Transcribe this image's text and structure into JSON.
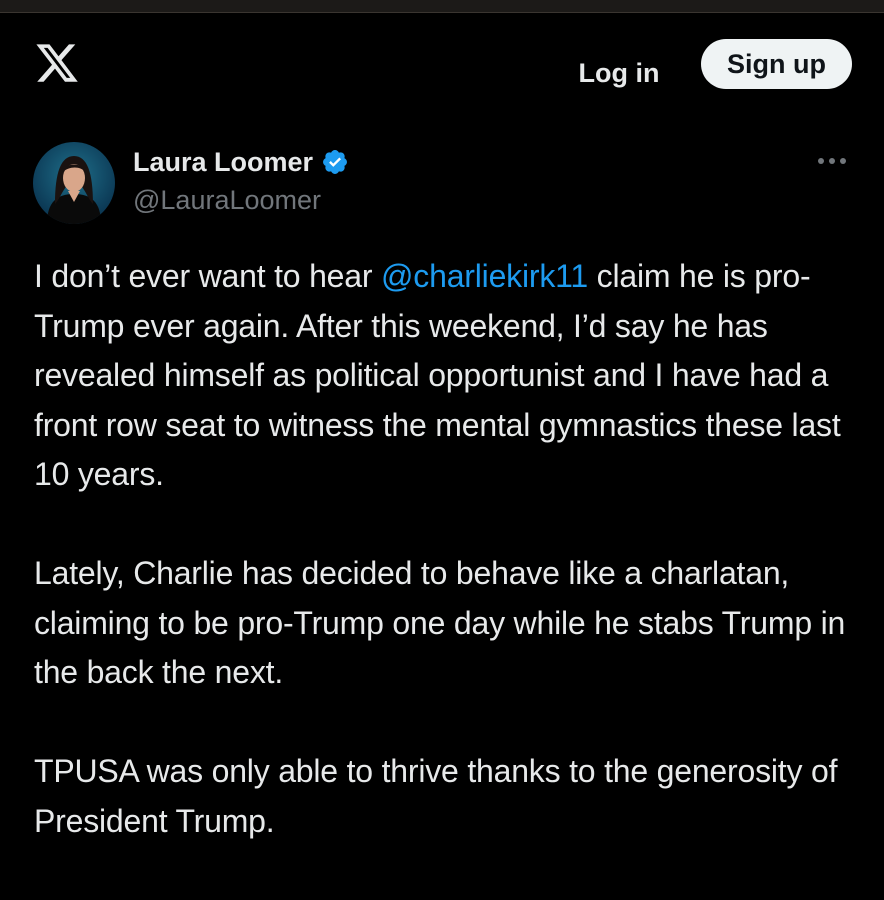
{
  "header": {
    "logo_icon": "x-logo-icon",
    "login_label": "Log in",
    "signup_label": "Sign up"
  },
  "tweet": {
    "author": {
      "name": "Laura Loomer",
      "handle": "@LauraLoomer",
      "verified": true,
      "verified_color": "#1d9bf0"
    },
    "more_icon": "more-horizontal-icon",
    "paragraphs": [
      {
        "before": "I don’t ever want to hear ",
        "mention": "@charliekirk11",
        "after": " claim he is pro-Trump ever again. After this weekend, I’d say he has revealed himself as political opportunist and I have had a front row seat to witness the mental gymnastics these last 10 years."
      },
      {
        "text": "Lately, Charlie has decided to behave like a charlatan, claiming to be pro-Trump one day while he stabs Trump in the back the next."
      },
      {
        "text": "TPUSA was only able to thrive thanks to the generosity of President Trump."
      }
    ]
  },
  "colors": {
    "background": "#000000",
    "text": "#e7e9ea",
    "secondary_text": "#71767b",
    "link": "#1d9bf0",
    "signup_bg": "#eff3f4"
  }
}
